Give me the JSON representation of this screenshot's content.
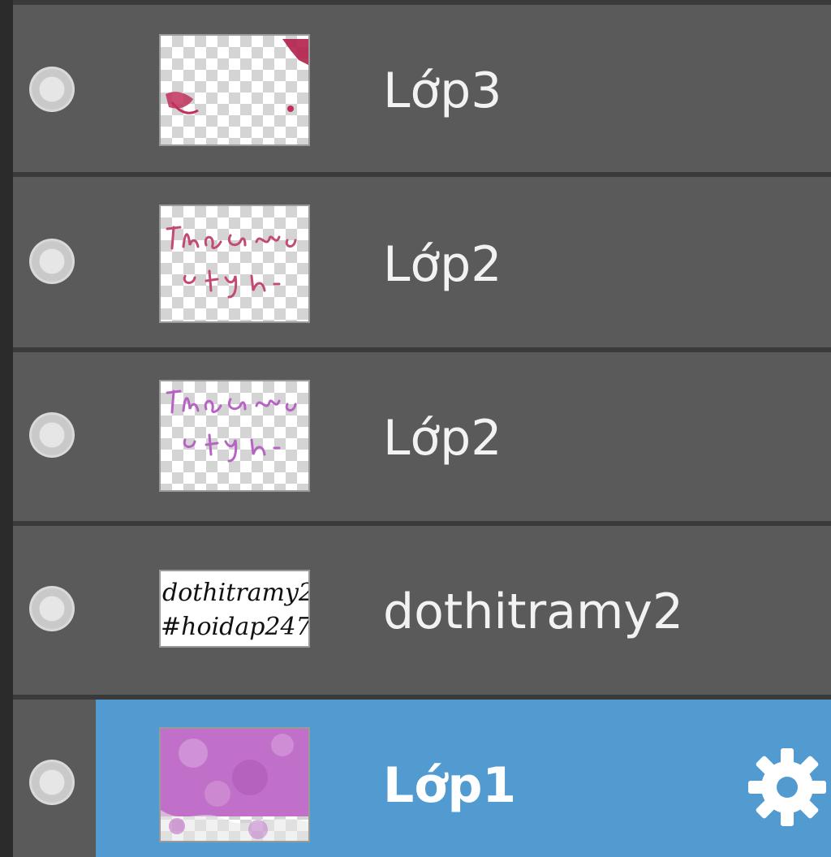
{
  "layers_panel": {
    "layers": [
      {
        "name": "Lớp3",
        "selected": false,
        "visible": true,
        "thumbnail": "pink-stamp-transparent"
      },
      {
        "name": "Lớp2",
        "selected": false,
        "visible": true,
        "thumbnail": "red-handwriting-transparent"
      },
      {
        "name": "Lớp2",
        "selected": false,
        "visible": true,
        "thumbnail": "purple-handwriting-transparent"
      },
      {
        "name": "dothitramy2",
        "selected": false,
        "visible": true,
        "thumbnail": "black-handwriting-text",
        "thumbnail_text": [
          "dothitramy2",
          "#hoidap247"
        ]
      },
      {
        "name": "Lớp1",
        "selected": true,
        "visible": true,
        "thumbnail": "purple-paint-texture"
      }
    ],
    "colors": {
      "row_background": "#5a5a5a",
      "selected_background": "#529bd1",
      "separator": "#2f2f2f",
      "text": "#f2f2f2"
    },
    "icons": {
      "visibility": "visibility-dot-icon",
      "settings": "gear-icon"
    }
  }
}
